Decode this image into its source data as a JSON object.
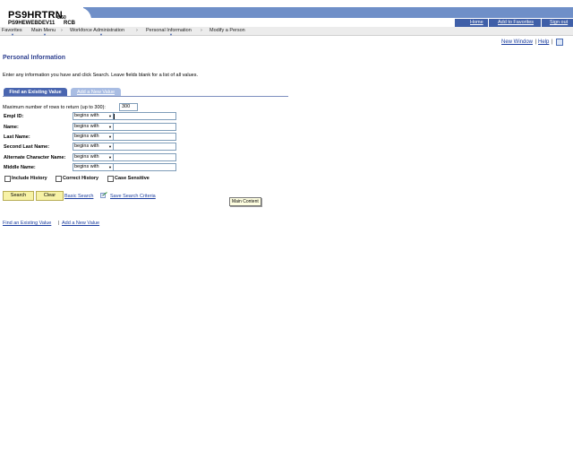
{
  "header": {
    "system_name": "PS9HRTRN",
    "version": "8.50",
    "server_name": "PS9HEWEBDEV11",
    "server_code": "RCB",
    "links": {
      "home": "Home",
      "add_to_favorites": "Add to Favorites",
      "sign_out": "Sign out"
    }
  },
  "menu": {
    "items": [
      "Favorites",
      "Main Menu",
      "Workforce Administration",
      "Personal Information",
      "Modify a Person"
    ],
    "separator": "›"
  },
  "page_links": {
    "new_window": "New Window",
    "help": "Help",
    "separator": "|"
  },
  "page": {
    "title": "Personal Information",
    "instructions": "Enter any information you have and click Search. Leave fields blank for a list of all values."
  },
  "tabs": {
    "find": "Find an Existing Value",
    "add": "Add a New Value"
  },
  "form": {
    "max_rows_label": "Maximum number of rows to return (up to 300):",
    "max_rows_value": "300",
    "fields": [
      {
        "label": "Empl ID:",
        "operator": "begins with",
        "value": ""
      },
      {
        "label": "Name:",
        "operator": "begins with",
        "value": ""
      },
      {
        "label": "Last Name:",
        "operator": "begins with",
        "value": ""
      },
      {
        "label": "Second Last Name:",
        "operator": "begins with",
        "value": ""
      },
      {
        "label": "Alternate Character Name:",
        "operator": "begins with",
        "value": ""
      },
      {
        "label": "Middle Name:",
        "operator": "begins with",
        "value": ""
      }
    ],
    "checkboxes": {
      "include_history": "Include History",
      "correct_history": "Correct History",
      "case_sensitive": "Case Sensitive"
    }
  },
  "actions": {
    "search": "Search",
    "clear": "Clear",
    "basic_search": "Basic Search",
    "save_criteria": "Save Search Criteria"
  },
  "tooltip": "Main Content",
  "footer": {
    "find": "Find an Existing Value",
    "add": "Add a New Value",
    "separator": "|"
  },
  "colors": {
    "header_band": "#6f8fc8",
    "util_bar": "#3f5fa8",
    "link": "#1a3c9e",
    "title": "#2d3f8f",
    "button": "#f7f2a6"
  }
}
